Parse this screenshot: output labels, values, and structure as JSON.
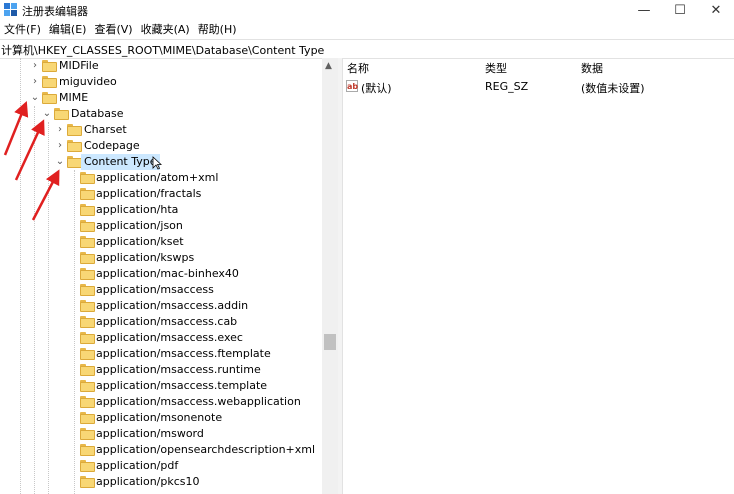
{
  "window": {
    "title": "注册表编辑器",
    "controls": {
      "minimize": "—",
      "maximize": "☐",
      "close": "✕"
    }
  },
  "menu": [
    "文件(F)",
    "编辑(E)",
    "查看(V)",
    "收藏夹(A)",
    "帮助(H)"
  ],
  "address": "计算机\\HKEY_CLASSES_ROOT\\MIME\\Database\\Content Type",
  "tree": {
    "top": [
      {
        "label": "MIDFile",
        "expanded": false
      },
      {
        "label": "miguvideo",
        "expanded": false
      },
      {
        "label": "MIME",
        "expanded": true
      }
    ],
    "database": {
      "label": "Database",
      "expanded": true
    },
    "database_children": [
      {
        "label": "Charset",
        "expanded": false
      },
      {
        "label": "Codepage",
        "expanded": false
      },
      {
        "label": "Content Type",
        "expanded": true,
        "selected": true
      }
    ],
    "content_type_children": [
      "application/atom+xml",
      "application/fractals",
      "application/hta",
      "application/json",
      "application/kset",
      "application/kswps",
      "application/mac-binhex40",
      "application/msaccess",
      "application/msaccess.addin",
      "application/msaccess.cab",
      "application/msaccess.exec",
      "application/msaccess.ftemplate",
      "application/msaccess.runtime",
      "application/msaccess.template",
      "application/msaccess.webapplication",
      "application/msonenote",
      "application/msword",
      "application/opensearchdescription+xml",
      "application/pdf",
      "application/pkcs10"
    ]
  },
  "list": {
    "columns": {
      "name": "名称",
      "type": "类型",
      "data": "数据"
    },
    "rows": [
      {
        "icon": "ab",
        "name": "(默认)",
        "type": "REG_SZ",
        "data": "(数值未设置)"
      }
    ]
  },
  "colors": {
    "selection": "#cce8ff",
    "folder": "#f8d775",
    "annotation_arrow": "#e02020"
  },
  "icons": {
    "app": "registry-editor-icon",
    "folder": "folder-icon",
    "expand": "chevron-right-icon",
    "collapse": "chevron-down-icon",
    "value": "string-value-icon"
  }
}
